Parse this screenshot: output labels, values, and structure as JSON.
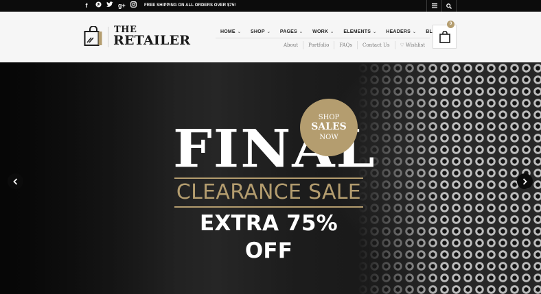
{
  "topbar": {
    "social": [
      {
        "icon": "facebook-icon",
        "glyph": "f"
      },
      {
        "icon": "pinterest-icon",
        "glyph": "℗"
      },
      {
        "icon": "twitter-icon",
        "glyph": "t"
      },
      {
        "icon": "google-plus-icon",
        "glyph": "g+"
      },
      {
        "icon": "instagram-icon",
        "glyph": "◘"
      }
    ],
    "shipping_text": "FREE SHIPPING ON ALL ORDERS OVER $75!"
  },
  "logo": {
    "line1": "THE",
    "line2": "RETAILER"
  },
  "main_nav": [
    {
      "label": "HOME",
      "dropdown": true
    },
    {
      "label": "SHOP",
      "dropdown": true
    },
    {
      "label": "PAGES",
      "dropdown": true
    },
    {
      "label": "WORK",
      "dropdown": true
    },
    {
      "label": "ELEMENTS",
      "dropdown": true
    },
    {
      "label": "HEADERS",
      "dropdown": true
    },
    {
      "label": "BLOG",
      "dropdown": false
    }
  ],
  "sub_nav": [
    "About",
    "Portfolio",
    "FAQs",
    "Contact Us",
    "Wishlist"
  ],
  "cart": {
    "count": "0"
  },
  "hero": {
    "badge": {
      "line1": "SHOP",
      "line2": "SALES",
      "line3": "NOW"
    },
    "headline": "FINAL",
    "subheadline": "CLEARANCE SALE",
    "offer": "EXTRA 75% OFF"
  },
  "colors": {
    "accent": "#b49d6f",
    "topbar": "#0c0c0c",
    "header": "#f6f6f6"
  }
}
